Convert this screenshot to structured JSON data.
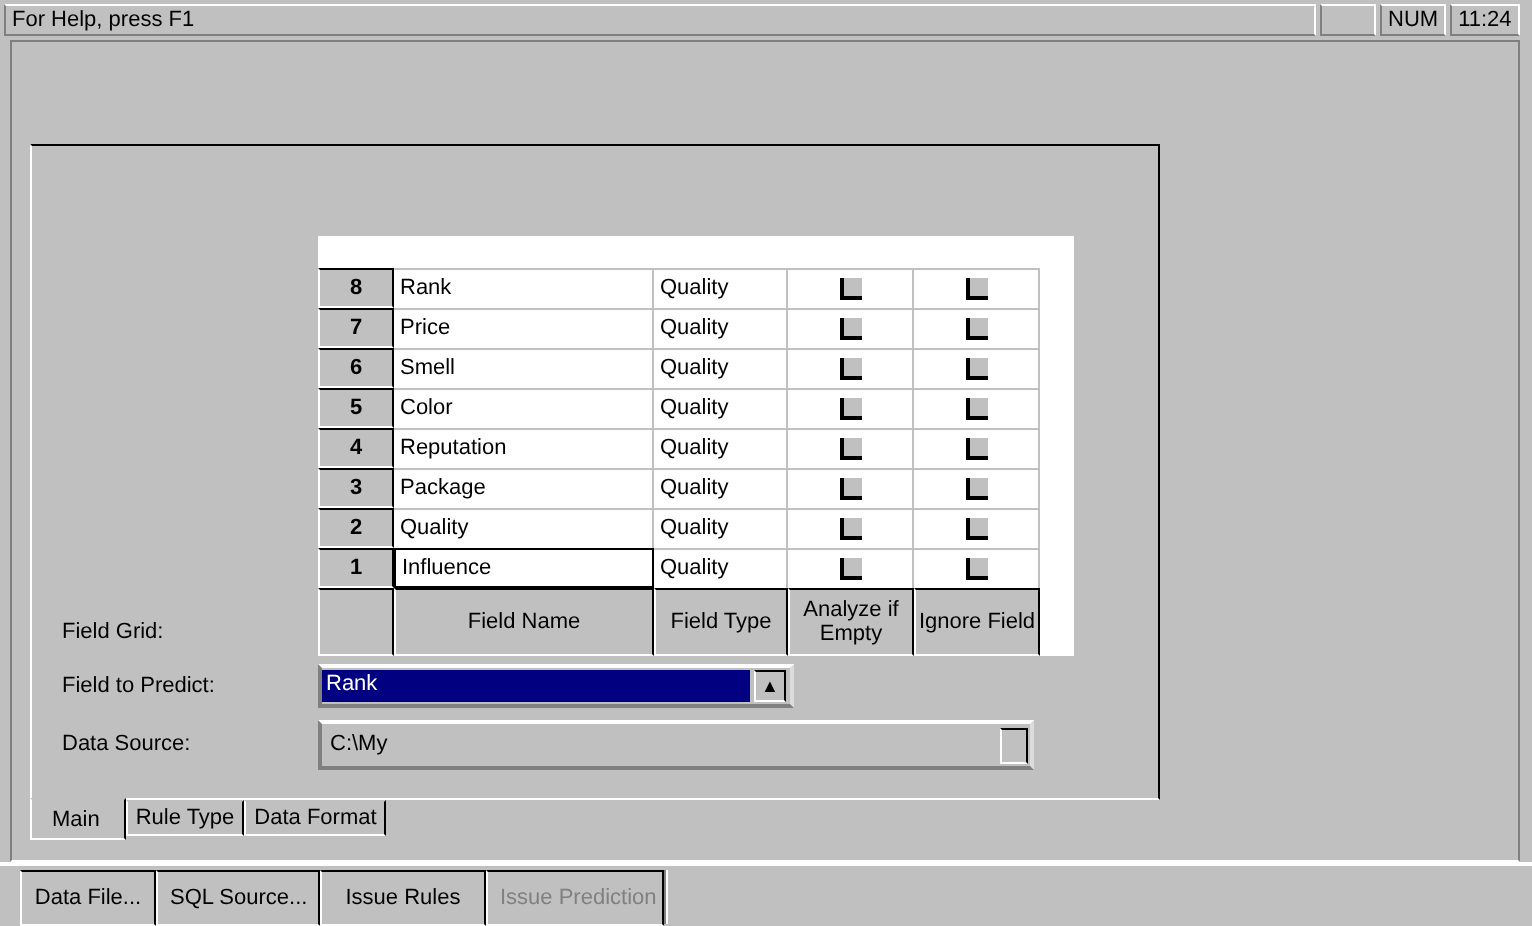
{
  "status_bar": {
    "message": "For Help, press F1",
    "indicator": "NUM",
    "time": "11:24"
  },
  "field_grid": {
    "label": "Field Grid:",
    "rows": [
      {
        "number": "8",
        "name": "Rank",
        "type": "Quality",
        "analyze_if_empty": false,
        "ignore": false,
        "selected": false
      },
      {
        "number": "7",
        "name": "Price",
        "type": "Quality",
        "analyze_if_empty": false,
        "ignore": false,
        "selected": false
      },
      {
        "number": "6",
        "name": "Smell",
        "type": "Quality",
        "analyze_if_empty": false,
        "ignore": false,
        "selected": false
      },
      {
        "number": "5",
        "name": "Color",
        "type": "Quality",
        "analyze_if_empty": false,
        "ignore": false,
        "selected": false
      },
      {
        "number": "4",
        "name": "Reputation",
        "type": "Quality",
        "analyze_if_empty": false,
        "ignore": false,
        "selected": false
      },
      {
        "number": "3",
        "name": "Package",
        "type": "Quality",
        "analyze_if_empty": false,
        "ignore": false,
        "selected": false
      },
      {
        "number": "2",
        "name": "Quality",
        "type": "Quality",
        "analyze_if_empty": false,
        "ignore": false,
        "selected": false
      },
      {
        "number": "1",
        "name": "Influence",
        "type": "Quality",
        "analyze_if_empty": false,
        "ignore": false,
        "selected": true
      }
    ],
    "columns": [
      "Field Name",
      "Field Type",
      "Analyze if Empty",
      "Ignore Field"
    ]
  },
  "field_to_predict": {
    "label": "Field to Predict:",
    "value": "Rank",
    "arrow": "▲"
  },
  "data_source": {
    "label": "Data Source:",
    "value": "C:\\My"
  },
  "tabs": [
    {
      "label": "Main",
      "selected": true
    },
    {
      "label": "Rule Type",
      "selected": false
    },
    {
      "label": "Data Format",
      "selected": false
    }
  ],
  "toolbar_buttons": [
    {
      "label": "Data File...",
      "disabled": false
    },
    {
      "label": "SQL Source...",
      "disabled": false
    },
    {
      "label": "Issue Rules",
      "disabled": false
    },
    {
      "label": "Issue Prediction",
      "disabled": true
    }
  ]
}
